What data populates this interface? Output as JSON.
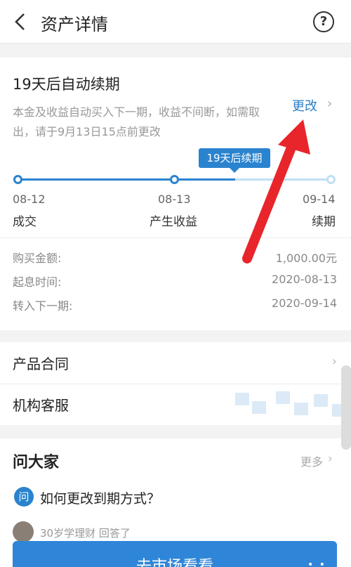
{
  "header": {
    "title": "资产详情",
    "help_symbol": "?"
  },
  "renewal": {
    "title": "19天后自动续期",
    "description": "本金及收益自动买入下一期，收益不间断，如需取出，请于9月13日15点前更改",
    "change_label": "更改",
    "tooltip": "19天后续期",
    "progress": 0.63,
    "timeline": [
      {
        "date": "08-12",
        "label": "成交"
      },
      {
        "date": "08-13",
        "label": "产生收益"
      },
      {
        "date": "09-14",
        "label": "续期"
      }
    ]
  },
  "info": [
    {
      "key": "购买金额:",
      "value": "1,000.00元"
    },
    {
      "key": "起息时间:",
      "value": "2020-08-13"
    },
    {
      "key": "转入下一期:",
      "value": "2020-09-14"
    }
  ],
  "links": [
    {
      "label": "产品合同"
    },
    {
      "label": "机构客服"
    }
  ],
  "ask": {
    "title": "问大家",
    "more_label": "更多",
    "question_badge": "问",
    "question": "如何更改到期方式？",
    "answer_meta": "30岁学理财 回答了"
  },
  "cta": {
    "label": "去市场看看"
  },
  "colors": {
    "accent": "#2a83cf",
    "arrow": "#e8252b"
  }
}
